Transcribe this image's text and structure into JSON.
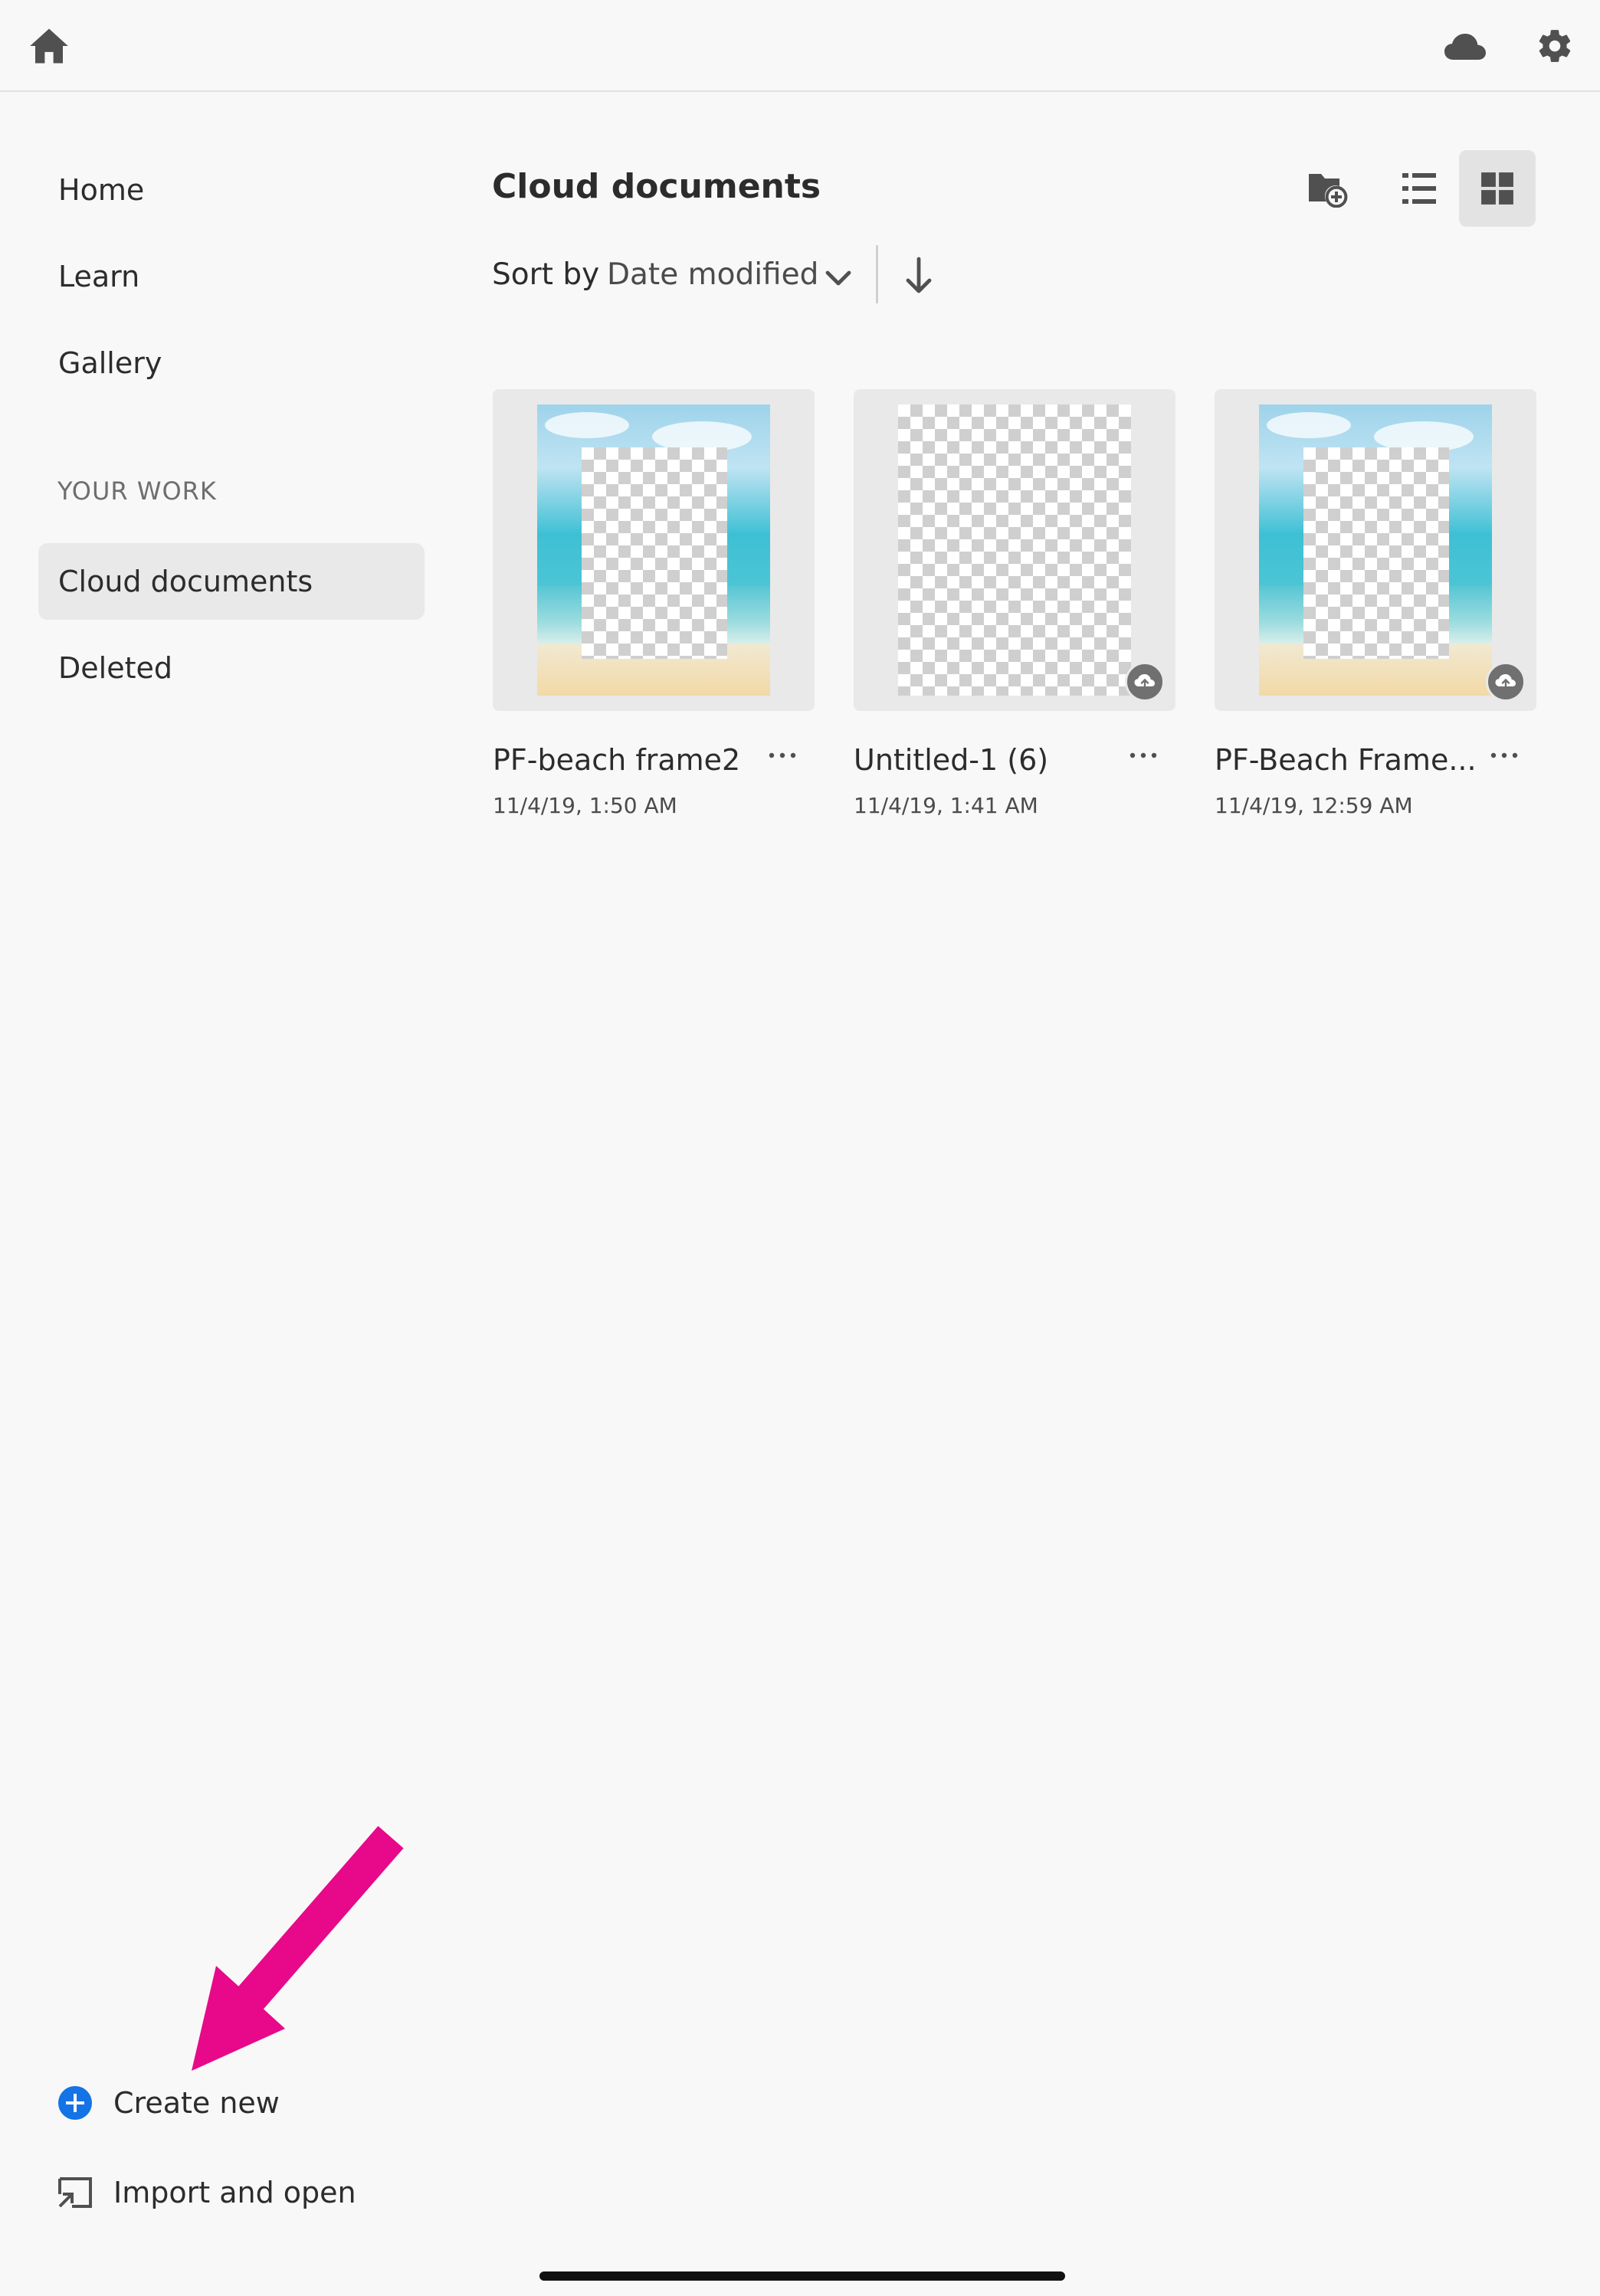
{
  "topbar": {
    "home_icon": "home-icon",
    "cloud_icon": "cloud-icon",
    "settings_icon": "gear-icon"
  },
  "sidebar": {
    "items": [
      {
        "label": "Home"
      },
      {
        "label": "Learn"
      },
      {
        "label": "Gallery"
      }
    ],
    "section_label": "YOUR WORK",
    "work_items": [
      {
        "label": "Cloud documents",
        "active": true
      },
      {
        "label": "Deleted",
        "active": false
      }
    ]
  },
  "main": {
    "title": "Cloud documents",
    "sort": {
      "label": "Sort by",
      "value": "Date modified"
    },
    "view_buttons": [
      "new-folder-icon",
      "list-view-icon",
      "grid-view-icon"
    ],
    "documents": [
      {
        "name": "PF-beach frame2",
        "date": "11/4/19, 1:50 AM",
        "thumbnail": "beach-frame",
        "cloud_badge": false
      },
      {
        "name": "Untitled-1 (6)",
        "date": "11/4/19, 1:41 AM",
        "thumbnail": "transparent",
        "cloud_badge": true
      },
      {
        "name": "PF-Beach Frame...",
        "date": "11/4/19, 12:59 AM",
        "thumbnail": "beach-frame",
        "cloud_badge": true
      }
    ]
  },
  "bottom_actions": {
    "create_new": "Create new",
    "import_open": "Import and open"
  },
  "colors": {
    "accent": "#1473e6",
    "annotation_arrow": "#e8088a",
    "background": "#f8f8f8"
  }
}
